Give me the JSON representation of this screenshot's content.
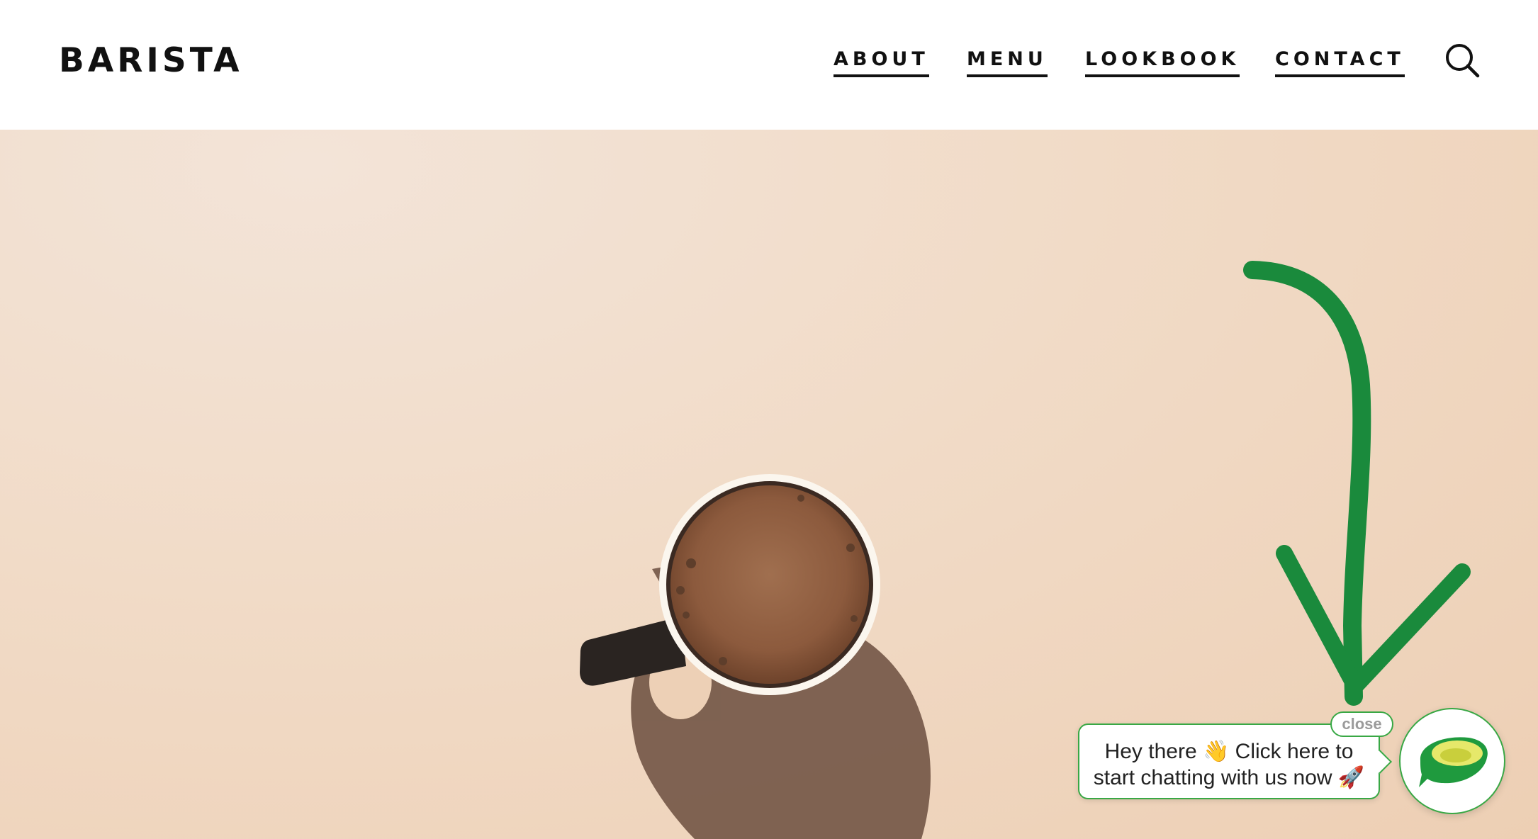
{
  "header": {
    "logo": "BARISTA",
    "nav": [
      {
        "label": "ABOUT"
      },
      {
        "label": "MENU"
      },
      {
        "label": "LOOKBOOK"
      },
      {
        "label": "CONTACT"
      }
    ],
    "search_icon": "search-icon"
  },
  "hero": {
    "image": "coffee-cup-photo",
    "background_color": "#f1dbc7",
    "arrow_color": "#1a8a3c"
  },
  "chat_widget": {
    "close_label": "close",
    "message_line1": "Hey there 👋  Click here to",
    "message_line2": "start chatting with us now 🚀",
    "launcher_icon": "chat-bubble-icon",
    "accent_color": "#39a845"
  }
}
